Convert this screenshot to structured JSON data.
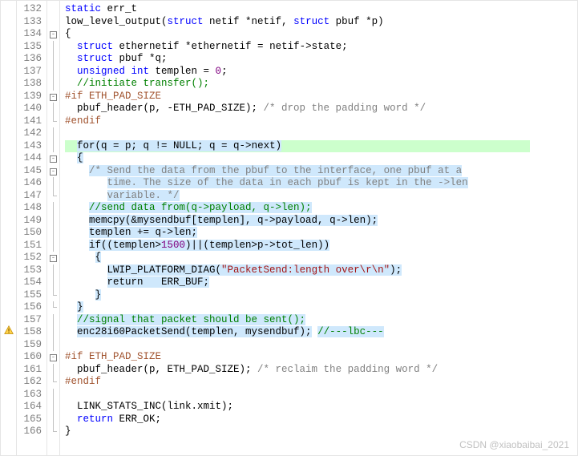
{
  "lines": [
    {
      "n": 132,
      "fold": "",
      "html": "<span class='kw'>static</span> err_t"
    },
    {
      "n": 133,
      "fold": "",
      "html": "low_level_output(<span class='kw'>struct</span> netif *netif, <span class='kw'>struct</span> pbuf *p)"
    },
    {
      "n": 134,
      "fold": "box",
      "html": "{"
    },
    {
      "n": 135,
      "fold": "line",
      "html": "  <span class='kw'>struct</span> ethernetif *ethernetif = netif-&gt;state;"
    },
    {
      "n": 136,
      "fold": "line",
      "html": "  <span class='kw'>struct</span> pbuf *q;"
    },
    {
      "n": 137,
      "fold": "line",
      "html": "  <span class='kw'>unsigned int</span> templen = <span class='num'>0</span>;"
    },
    {
      "n": 138,
      "fold": "line",
      "html": "  <span class='cmt-g'>//initiate transfer();</span>"
    },
    {
      "n": 139,
      "fold": "box",
      "html": "<span class='preproc'>#if ETH_PAD_SIZE</span>"
    },
    {
      "n": 140,
      "fold": "line",
      "html": "  pbuf_header(p, -ETH_PAD_SIZE); <span class='cmt-d'>/* drop the padding word */</span>"
    },
    {
      "n": 141,
      "fold": "end",
      "html": "<span class='preproc'>#endif</span>"
    },
    {
      "n": 142,
      "fold": "line",
      "html": ""
    },
    {
      "n": 143,
      "fold": "line",
      "hl": true,
      "html": "  <span class='sel'>for</span><span class='sel'>(q = p; q != NULL; q = q-&gt;next)</span>"
    },
    {
      "n": 144,
      "fold": "box",
      "html": "  <span class='sel'>{</span>"
    },
    {
      "n": 145,
      "fold": "box",
      "html": "    <span class='sel cmt-d'>/* Send the data from the pbuf to the interface, one pbuf at a</span>"
    },
    {
      "n": 146,
      "fold": "line",
      "html": "       <span class='sel cmt-d'>time. The size of the data in each pbuf is kept in the -&gt;len</span>"
    },
    {
      "n": 147,
      "fold": "end",
      "html": "       <span class='sel cmt-d'>variable. */</span>"
    },
    {
      "n": 148,
      "fold": "line",
      "html": "    <span class='sel cmt-g'>//send data from(q-&gt;payload, q-&gt;len);</span>"
    },
    {
      "n": 149,
      "fold": "line",
      "html": "    <span class='sel'>memcpy(&amp;mysendbuf[templen], q-&gt;payload, q-&gt;len);</span>"
    },
    {
      "n": 150,
      "fold": "line",
      "html": "    <span class='sel'>templen += q-&gt;len;</span>"
    },
    {
      "n": 151,
      "fold": "line",
      "html": "    <span class='sel'>if((templen&gt;</span><span class='sel num'>1500</span><span class='sel'>)||(templen&gt;p-&gt;tot_len))</span>"
    },
    {
      "n": 152,
      "fold": "box",
      "html": "     <span class='sel'>{</span>"
    },
    {
      "n": 153,
      "fold": "line",
      "html": "       <span class='sel'>LWIP_PLATFORM_DIAG(</span><span class='sel str'>\"PacketSend:length over\\r\\n\"</span><span class='sel'>);</span>"
    },
    {
      "n": 154,
      "fold": "line",
      "html": "       <span class='sel'>return   ERR_BUF;</span>"
    },
    {
      "n": 155,
      "fold": "end",
      "html": "     <span class='sel'>}</span>"
    },
    {
      "n": 156,
      "fold": "end",
      "html": "  <span class='sel'>}</span>"
    },
    {
      "n": 157,
      "fold": "line",
      "html": "  <span class='sel cmt-g'>//signal that packet should be sent();</span>"
    },
    {
      "n": 158,
      "fold": "line",
      "warn": true,
      "html": "  <span class='sel'>enc28i60PacketSend(templen, mysendbuf);</span> <span class='sel cmt-g'>//---lbc---</span>"
    },
    {
      "n": 159,
      "fold": "line",
      "html": ""
    },
    {
      "n": 160,
      "fold": "box",
      "html": "<span class='preproc'>#if ETH_PAD_SIZE</span>"
    },
    {
      "n": 161,
      "fold": "line",
      "html": "  pbuf_header(p, ETH_PAD_SIZE); <span class='cmt-d'>/* reclaim the padding word */</span>"
    },
    {
      "n": 162,
      "fold": "end",
      "html": "<span class='preproc'>#endif</span>"
    },
    {
      "n": 163,
      "fold": "line",
      "html": ""
    },
    {
      "n": 164,
      "fold": "line",
      "html": "  LINK_STATS_INC(link.xmit);"
    },
    {
      "n": 165,
      "fold": "line",
      "html": "  <span class='kw'>return</span> ERR_OK;"
    },
    {
      "n": 166,
      "fold": "end",
      "html": "}"
    }
  ],
  "watermark": "CSDN @xiaobaibai_2021"
}
